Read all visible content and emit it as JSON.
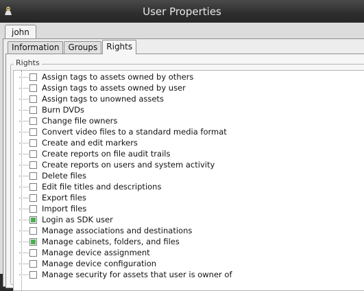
{
  "window": {
    "title": "User Properties"
  },
  "user_tab": {
    "label": "john"
  },
  "tabs": [
    {
      "label": "Information",
      "active": false
    },
    {
      "label": "Groups",
      "active": false
    },
    {
      "label": "Rights",
      "active": true
    }
  ],
  "rights_group": {
    "label": "Rights"
  },
  "rights": [
    {
      "label": "Assign tags to assets owned by others",
      "checked": false
    },
    {
      "label": "Assign tags to assets owned by user",
      "checked": false
    },
    {
      "label": "Assign tags to unowned assets",
      "checked": false
    },
    {
      "label": "Burn DVDs",
      "checked": false
    },
    {
      "label": "Change file owners",
      "checked": false
    },
    {
      "label": "Convert video files to a standard media format",
      "checked": false
    },
    {
      "label": "Create and edit markers",
      "checked": false
    },
    {
      "label": "Create reports on file audit trails",
      "checked": false
    },
    {
      "label": "Create reports on users and system activity",
      "checked": false
    },
    {
      "label": "Delete files",
      "checked": false
    },
    {
      "label": "Edit file titles and descriptions",
      "checked": false
    },
    {
      "label": "Export files",
      "checked": false
    },
    {
      "label": "Import files",
      "checked": false
    },
    {
      "label": "Login as SDK user",
      "checked": true
    },
    {
      "label": "Manage associations and destinations",
      "checked": false
    },
    {
      "label": "Manage cabinets, folders, and files",
      "checked": true
    },
    {
      "label": "Manage device assignment",
      "checked": false
    },
    {
      "label": "Manage device configuration",
      "checked": false
    },
    {
      "label": "Manage security for assets that user is owner of",
      "checked": false
    }
  ],
  "colors": {
    "checked_fill": "#4caf50",
    "titlebar": "#2e2e2e"
  }
}
